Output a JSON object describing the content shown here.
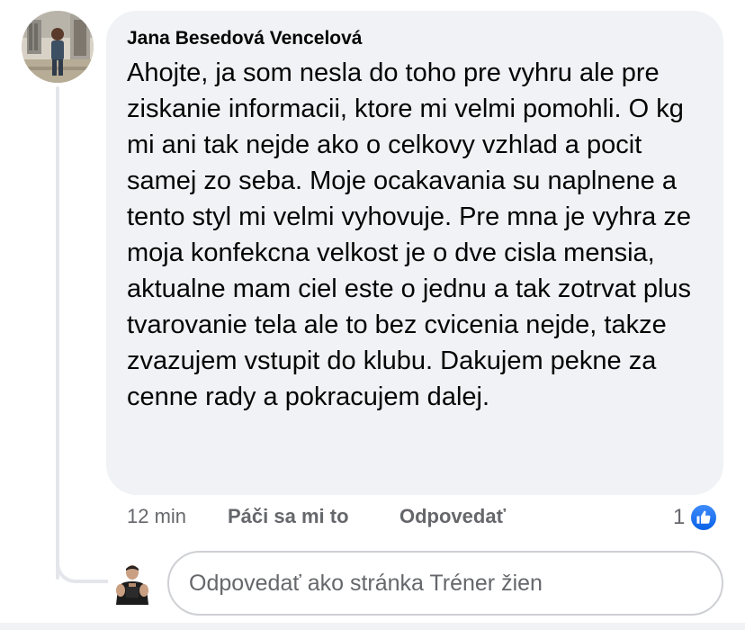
{
  "comment": {
    "author": "Jana Besedová Vencelová",
    "text": "Ahojte, ja som nesla do toho pre vyhru ale pre ziskanie informacii, ktore mi velmi pomohli. O kg mi ani tak nejde ako o celkovy vzhlad a pocit samej zo seba. Moje ocakavania su naplnene a tento styl mi velmi vyhovuje. Pre mna je vyhra ze moja konfekcna velkost je o dve cisla mensia, aktualne mam ciel este o jednu a tak zotrvat plus tvarovanie tela ale to bez cvicenia nejde, takze zvazujem vstupit do klubu. Dakujem pekne za cenne rady a pokracujem dalej.",
    "timestamp": "12 min",
    "like_label": "Páči sa mi to",
    "reply_label": "Odpovedať",
    "reaction_count": "1",
    "reaction_icon": "like-thumb-icon"
  },
  "reply_box": {
    "placeholder": "Odpovedať ako stránka Tréner žien"
  },
  "colors": {
    "bubble_bg": "#f0f2f5",
    "secondary_text": "#65676b",
    "like_blue": "#1877f2"
  }
}
